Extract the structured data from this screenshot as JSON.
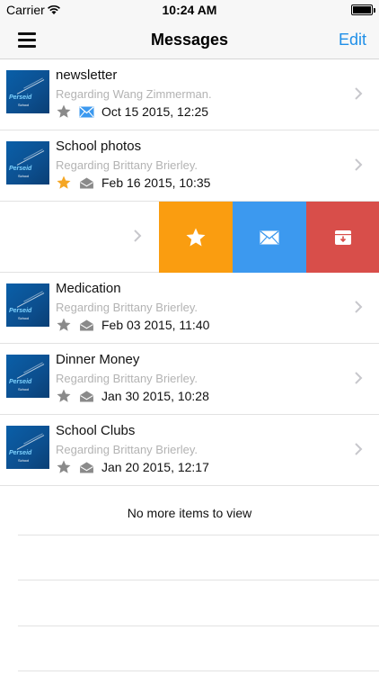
{
  "status": {
    "carrier": "Carrier",
    "time": "10:24 AM"
  },
  "nav": {
    "title": "Messages",
    "edit": "Edit"
  },
  "messages": [
    {
      "subject": "newsletter",
      "regarding": "Regarding Wang Zimmerman.",
      "date": "Oct 15 2015, 12:25",
      "starred": false,
      "unread": true
    },
    {
      "subject": "School photos",
      "regarding": "Regarding Brittany Brierley.",
      "date": "Feb 16 2015, 10:35",
      "starred": true,
      "unread": false
    },
    {
      "subject": "Medication",
      "regarding": "Regarding Brittany Brierley.",
      "date": "Feb 03 2015, 11:40",
      "starred": false,
      "unread": false
    },
    {
      "subject": "Dinner Money",
      "regarding": "Regarding Brittany Brierley.",
      "date": "Jan 30 2015, 10:28",
      "starred": false,
      "unread": false
    },
    {
      "subject": "School Clubs",
      "regarding": "Regarding Brittany Brierley.",
      "date": "Jan 20 2015, 12:17",
      "starred": false,
      "unread": false
    }
  ],
  "swipe_actions": {
    "star_color": "#fa9d10",
    "mail_color": "#3c99ef",
    "archive_color": "#d84e4a"
  },
  "thumb_logo": {
    "name": "Perseid",
    "sub": "School"
  },
  "footer": {
    "no_more": "No more items to view"
  },
  "colors": {
    "accent": "#1f8fe8",
    "star_on": "#f5a623",
    "star_off": "#8a8a8a",
    "unread_env": "#3c99ef"
  }
}
